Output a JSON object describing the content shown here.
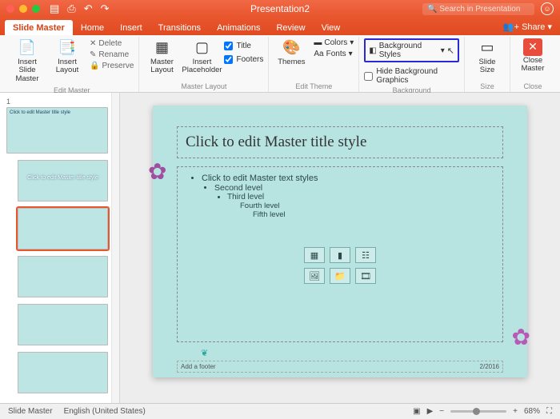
{
  "window": {
    "title": "Presentation2",
    "search_placeholder": "Search in Presentation"
  },
  "tabs": {
    "slide_master": "Slide Master",
    "home": "Home",
    "insert": "Insert",
    "transitions": "Transitions",
    "animations": "Animations",
    "review": "Review",
    "view": "View",
    "share": "Share"
  },
  "ribbon": {
    "edit_master": {
      "insert_slide_master": "Insert Slide Master",
      "insert_layout": "Insert Layout",
      "delete": "Delete",
      "rename": "Rename",
      "preserve": "Preserve",
      "label": "Edit Master"
    },
    "master_layout": {
      "master_layout": "Master Layout",
      "insert_placeholder": "Insert Placeholder",
      "title_chk": "Title",
      "footers_chk": "Footers",
      "label": "Master Layout"
    },
    "edit_theme": {
      "themes": "Themes",
      "colors": "Colors",
      "fonts": "Fonts",
      "label": "Edit Theme"
    },
    "background": {
      "bg_styles": "Background Styles",
      "hide_bg": "Hide Background Graphics",
      "label": "Background"
    },
    "size": {
      "slide_size": "Slide Size",
      "label": "Size"
    },
    "close": {
      "close_master": "Close Master",
      "label": "Close"
    }
  },
  "thumbs": {
    "page1": "1",
    "master_caption": "Click to edit Master title style"
  },
  "slide": {
    "title": "Click to edit Master title style",
    "b1": "Click to edit Master text styles",
    "b2": "Second level",
    "b3": "Third level",
    "b4": "Fourth level",
    "b5": "Fifth level",
    "footer_left": "Add a footer",
    "footer_right": "2/2016"
  },
  "status": {
    "mode": "Slide Master",
    "lang": "English (United States)",
    "zoom": "68%"
  }
}
